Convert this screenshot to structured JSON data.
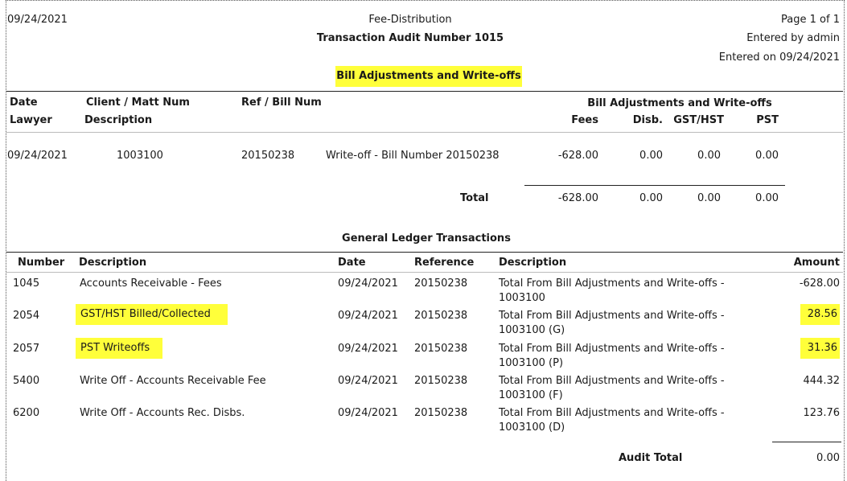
{
  "header": {
    "date": "09/24/2021",
    "report_name": "Fee-Distribution",
    "audit_title": "Transaction Audit Number 1015",
    "page": "Page 1 of 1",
    "entered_by": "Entered by admin",
    "entered_on": "Entered on 09/24/2021",
    "section_title": "Bill Adjustments and Write-offs"
  },
  "bill_table": {
    "col_date": "Date",
    "col_lawyer": "Lawyer",
    "col_client": "Client / Matt Num",
    "col_description": "Description",
    "col_ref": "Ref / Bill Num",
    "group_header": "Bill Adjustments and Write-offs",
    "col_fees": "Fees",
    "col_disb": "Disb.",
    "col_gst": "GST/HST",
    "col_pst": "PST",
    "row": {
      "date": "09/24/2021",
      "client": "1003100",
      "ref": "20150238",
      "description": "Write-off - Bill Number 20150238",
      "fees": "-628.00",
      "disb": "0.00",
      "gst": "0.00",
      "pst": "0.00"
    },
    "total": {
      "label": "Total",
      "fees": "-628.00",
      "disb": "0.00",
      "gst": "0.00",
      "pst": "0.00"
    }
  },
  "gl": {
    "title": "General Ledger Transactions",
    "col_number": "Number",
    "col_description": "Description",
    "col_date": "Date",
    "col_reference": "Reference",
    "col_description2": "Description",
    "col_amount": "Amount",
    "rows": [
      {
        "number": "1045",
        "description": "Accounts Receivable - Fees",
        "date": "09/24/2021",
        "reference": "20150238",
        "desc2_line1": "Total From Bill Adjustments and Write-offs -",
        "desc2_line2": "1003100",
        "amount": "-628.00"
      },
      {
        "number": "2054",
        "description": "GST/HST Billed/Collected",
        "date": "09/24/2021",
        "reference": "20150238",
        "desc2_line1": "Total From Bill Adjustments and Write-offs -",
        "desc2_line2": "1003100 (G)",
        "amount": "28.56"
      },
      {
        "number": "2057",
        "description": "PST Writeoffs",
        "date": "09/24/2021",
        "reference": "20150238",
        "desc2_line1": "Total From Bill Adjustments and Write-offs -",
        "desc2_line2": "1003100 (P)",
        "amount": "31.36"
      },
      {
        "number": "5400",
        "description": "Write Off - Accounts Receivable Fee",
        "date": "09/24/2021",
        "reference": "20150238",
        "desc2_line1": "Total From Bill Adjustments and Write-offs -",
        "desc2_line2": "1003100 (F)",
        "amount": "444.32"
      },
      {
        "number": "6200",
        "description": "Write Off - Accounts Rec. Disbs.",
        "date": "09/24/2021",
        "reference": "20150238",
        "desc2_line1": "Total From Bill Adjustments and Write-offs -",
        "desc2_line2": "1003100 (D)",
        "amount": "123.76"
      }
    ],
    "audit_total_label": "Audit Total",
    "audit_total_value": "0.00"
  },
  "highlight_color": "#ffff3a"
}
